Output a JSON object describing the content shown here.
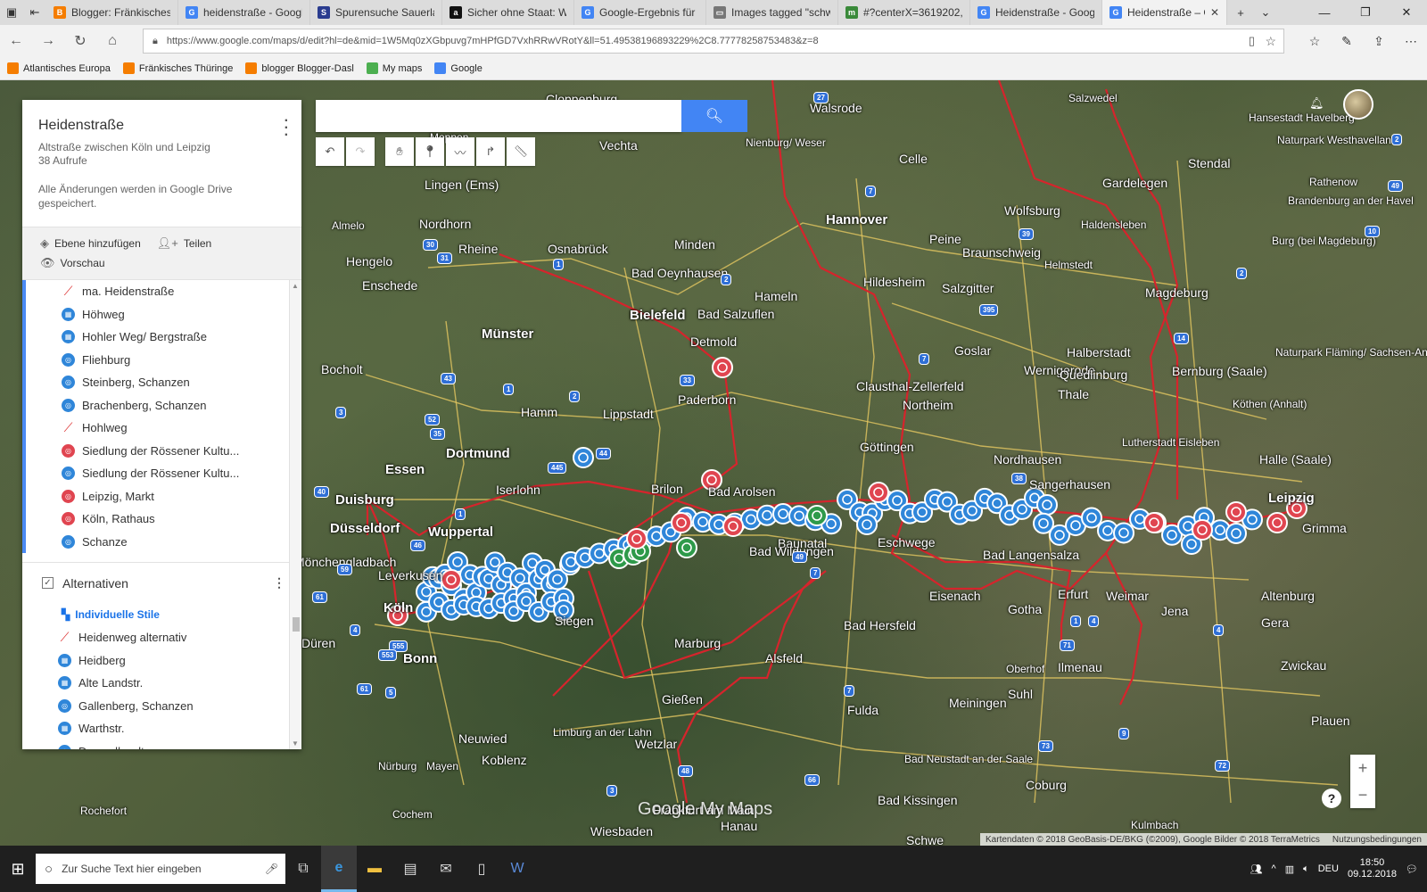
{
  "browser": {
    "tabs": [
      {
        "title": "Blogger: Fränkisches Th",
        "icon_color": "#f57d00",
        "icon": "B",
        "active": false
      },
      {
        "title": "heidenstraße - Google-",
        "icon_color": "#4285f4",
        "icon": "G",
        "active": false
      },
      {
        "title": "Spurensuche Sauerland",
        "icon_color": "#2a3c8f",
        "icon": "S",
        "active": false
      },
      {
        "title": "Sicher ohne Staat: Wie",
        "icon_color": "#111111",
        "icon": "a",
        "active": false
      },
      {
        "title": "Google-Ergebnis für htt",
        "icon_color": "#4285f4",
        "icon": "G",
        "active": false
      },
      {
        "title": "Images tagged \"schwed",
        "icon_color": "#777777",
        "icon": "▭",
        "active": false
      },
      {
        "title": "#?centerX=3619202,69:",
        "icon_color": "#3a8a3a",
        "icon": "m",
        "active": false
      },
      {
        "title": "Heidenstraße - Google",
        "icon_color": "#4285f4",
        "icon": "G",
        "active": false
      },
      {
        "title": "Heidenstraße – Goc",
        "icon_color": "#4285f4",
        "icon": "G",
        "active": true
      }
    ],
    "url": "https://www.google.com/maps/d/edit?hl=de&mid=1W5Mq0zXGbpuvg7mHPfGD7VxhRRwVRotY&ll=51.49538196893229%2C8.77778258753483&z=8",
    "favorites": [
      {
        "label": "Atlantisches Europa",
        "color": "#f57d00"
      },
      {
        "label": "Fränkisches Thüringe",
        "color": "#f57d00"
      },
      {
        "label": "blogger Blogger-Dasl",
        "color": "#f57d00"
      },
      {
        "label": "My maps",
        "color": "#4caf50"
      },
      {
        "label": "Google",
        "color": "#4285f4"
      }
    ]
  },
  "panel": {
    "title": "Heidenstraße",
    "subtitle": "Altstraße zwischen Köln und Leipzig",
    "views": "38 Aufrufe",
    "saved": "Alle Änderungen werden in Google Drive gespeichert.",
    "add_layer": "Ebene hinzufügen",
    "share": "Teilen",
    "preview": "Vorschau",
    "layer1_items": [
      {
        "label": "ma. Heidenstraße",
        "icon": "line-icon",
        "color": "red"
      },
      {
        "label": "Höhweg",
        "icon": "fortress-icon",
        "color": "blue"
      },
      {
        "label": "Hohler Weg/ Bergstraße",
        "icon": "fortress-icon",
        "color": "blue"
      },
      {
        "label": "Fliehburg",
        "icon": "target-icon",
        "color": "blue"
      },
      {
        "label": "Steinberg, Schanzen",
        "icon": "target-icon",
        "color": "blue"
      },
      {
        "label": "Brachenberg, Schanzen",
        "icon": "target-icon",
        "color": "blue"
      },
      {
        "label": "Hohlweg",
        "icon": "line-icon",
        "color": "red"
      },
      {
        "label": "Siedlung der Rössener Kultu...",
        "icon": "target-icon",
        "color": "red"
      },
      {
        "label": "Siedlung der Rössener Kultu...",
        "icon": "target-icon",
        "color": "blue"
      },
      {
        "label": "Leipzig, Markt",
        "icon": "target-icon",
        "color": "red"
      },
      {
        "label": "Köln, Rathaus",
        "icon": "target-icon",
        "color": "red"
      },
      {
        "label": "Schanze",
        "icon": "target-icon",
        "color": "blue"
      }
    ],
    "layer2": {
      "name": "Alternativen",
      "style_link": "Individuelle Stile",
      "items": [
        {
          "label": "Heidenweg alternativ",
          "icon": "line-icon",
          "color": "red"
        },
        {
          "label": "Heidberg",
          "icon": "fortress-icon",
          "color": "blue"
        },
        {
          "label": "Alte Landstr.",
          "icon": "fortress-icon",
          "color": "blue"
        },
        {
          "label": "Gallenberg, Schanzen",
          "icon": "target-icon",
          "color": "blue"
        },
        {
          "label": "Warthstr.",
          "icon": "fortress-icon",
          "color": "blue"
        },
        {
          "label": "Drosselhardt",
          "icon": "target-icon",
          "color": "blue"
        }
      ]
    }
  },
  "map": {
    "cities": [
      {
        "name": "Cloppenburg",
        "size": "normal"
      },
      {
        "name": "Walsrode",
        "size": "normal"
      },
      {
        "name": "Salzwedel",
        "size": "sm"
      },
      {
        "name": "Meppen",
        "size": "sm"
      },
      {
        "name": "Vechta",
        "size": "normal"
      },
      {
        "name": "Nienburg/ Weser",
        "size": "sm"
      },
      {
        "name": "Celle",
        "size": "normal"
      },
      {
        "name": "Hansestadt Havelberg",
        "size": "sm"
      },
      {
        "name": "Naturpark Westhavelland",
        "size": "sm"
      },
      {
        "name": "Stendal",
        "size": "normal"
      },
      {
        "name": "Lingen (Ems)",
        "size": "normal"
      },
      {
        "name": "Gardelegen",
        "size": "normal"
      },
      {
        "name": "Rathenow",
        "size": "sm"
      },
      {
        "name": "Nordhorn",
        "size": "normal"
      },
      {
        "name": "Hannover",
        "size": "big"
      },
      {
        "name": "Wolfsburg",
        "size": "normal"
      },
      {
        "name": "Brandenburg an der Havel",
        "size": "sm"
      },
      {
        "name": "Almelo",
        "size": "sm"
      },
      {
        "name": "Rheine",
        "size": "normal"
      },
      {
        "name": "Osnabrück",
        "size": "normal"
      },
      {
        "name": "Minden",
        "size": "normal"
      },
      {
        "name": "Peine",
        "size": "normal"
      },
      {
        "name": "Braunschweig",
        "size": "normal"
      },
      {
        "name": "Haldensleben",
        "size": "sm"
      },
      {
        "name": "Hengelo",
        "size": "normal"
      },
      {
        "name": "Burg (bei Magdeburg)",
        "size": "sm"
      },
      {
        "name": "Helmstedt",
        "size": "sm"
      },
      {
        "name": "Enschede",
        "size": "normal"
      },
      {
        "name": "Bad Oeynhausen",
        "size": "normal"
      },
      {
        "name": "Hameln",
        "size": "normal"
      },
      {
        "name": "Hildesheim",
        "size": "normal"
      },
      {
        "name": "Salzgitter",
        "size": "normal"
      },
      {
        "name": "Magdeburg",
        "size": "normal"
      },
      {
        "name": "Bielefeld",
        "size": "big"
      },
      {
        "name": "Bad Salzuflen",
        "size": "normal"
      },
      {
        "name": "Münster",
        "size": "big"
      },
      {
        "name": "Detmold",
        "size": "normal"
      },
      {
        "name": "Goslar",
        "size": "normal"
      },
      {
        "name": "Halberstadt",
        "size": "normal"
      },
      {
        "name": "Bocholt",
        "size": "normal"
      },
      {
        "name": "Wernigerode",
        "size": "normal"
      },
      {
        "name": "Quedlinburg",
        "size": "normal"
      },
      {
        "name": "Bernburg (Saale)",
        "size": "normal"
      },
      {
        "name": "Naturpark Fläming/ Sachsen-Anhalt",
        "size": "sm"
      },
      {
        "name": "Paderborn",
        "size": "normal"
      },
      {
        "name": "Clausthal-Zellerfeld",
        "size": "normal"
      },
      {
        "name": "Thale",
        "size": "normal"
      },
      {
        "name": "Hamm",
        "size": "normal"
      },
      {
        "name": "Lippstadt",
        "size": "normal"
      },
      {
        "name": "Northeim",
        "size": "normal"
      },
      {
        "name": "Köthen (Anhalt)",
        "size": "sm"
      },
      {
        "name": "Göttingen",
        "size": "normal"
      },
      {
        "name": "Lutherstadt Eisleben",
        "size": "sm"
      },
      {
        "name": "Essen",
        "size": "big"
      },
      {
        "name": "Dortmund",
        "size": "big"
      },
      {
        "name": "Nordhausen",
        "size": "normal"
      },
      {
        "name": "Halle (Saale)",
        "size": "normal"
      },
      {
        "name": "Duisburg",
        "size": "big"
      },
      {
        "name": "Iserlohn",
        "size": "normal"
      },
      {
        "name": "Brilon",
        "size": "normal"
      },
      {
        "name": "Bad Arolsen",
        "size": "normal"
      },
      {
        "name": "Sangerhausen",
        "size": "normal"
      },
      {
        "name": "Leipzig",
        "size": "big"
      },
      {
        "name": "Düsseldorf",
        "size": "big"
      },
      {
        "name": "Wuppertal",
        "size": "big"
      },
      {
        "name": "Baunatal",
        "size": "normal"
      },
      {
        "name": "Eschwege",
        "size": "normal"
      },
      {
        "name": "Grimma",
        "size": "normal"
      },
      {
        "name": "Mönchengladbach",
        "size": "normal"
      },
      {
        "name": "Bad Wildungen",
        "size": "normal"
      },
      {
        "name": "Bad Langensalza",
        "size": "normal"
      },
      {
        "name": "Leverkusen",
        "size": "normal"
      },
      {
        "name": "Köln",
        "size": "big"
      },
      {
        "name": "Siegen",
        "size": "normal"
      },
      {
        "name": "Eisenach",
        "size": "normal"
      },
      {
        "name": "Gotha",
        "size": "normal"
      },
      {
        "name": "Erfurt",
        "size": "normal"
      },
      {
        "name": "Weimar",
        "size": "normal"
      },
      {
        "name": "Jena",
        "size": "normal"
      },
      {
        "name": "Altenburg",
        "size": "normal"
      },
      {
        "name": "Düren",
        "size": "normal"
      },
      {
        "name": "Bonn",
        "size": "big"
      },
      {
        "name": "Marburg",
        "size": "normal"
      },
      {
        "name": "Bad Hersfeld",
        "size": "normal"
      },
      {
        "name": "Alsfeld",
        "size": "normal"
      },
      {
        "name": "Gera",
        "size": "normal"
      },
      {
        "name": "Zwickau",
        "size": "normal"
      },
      {
        "name": "Oberhof",
        "size": "sm"
      },
      {
        "name": "Suhl",
        "size": "normal"
      },
      {
        "name": "Ilmenau",
        "size": "normal"
      },
      {
        "name": "Gießen",
        "size": "normal"
      },
      {
        "name": "Fulda",
        "size": "normal"
      },
      {
        "name": "Meiningen",
        "size": "normal"
      },
      {
        "name": "Neuwied",
        "size": "normal"
      },
      {
        "name": "Wetzlar",
        "size": "normal"
      },
      {
        "name": "Limburg an der Lahn",
        "size": "sm"
      },
      {
        "name": "Plauen",
        "size": "normal"
      },
      {
        "name": "Koblenz",
        "size": "normal"
      },
      {
        "name": "Bad Neustadt an der Saale",
        "size": "sm"
      },
      {
        "name": "Nürburg",
        "size": "sm"
      },
      {
        "name": "Mayen",
        "size": "sm"
      },
      {
        "name": "Coburg",
        "size": "normal"
      },
      {
        "name": "Rochefort",
        "size": "sm"
      },
      {
        "name": "Bad Kissingen",
        "size": "normal"
      },
      {
        "name": "Cochem",
        "size": "sm"
      },
      {
        "name": "Frankfurt am Main",
        "size": "normal"
      },
      {
        "name": "Hanau",
        "size": "normal"
      },
      {
        "name": "Kulmbach",
        "size": "sm"
      },
      {
        "name": "Wiesbaden",
        "size": "normal"
      },
      {
        "name": "Schwe",
        "size": "normal"
      }
    ],
    "road_numbers": [
      "27",
      "7",
      "30",
      "31",
      "1",
      "2",
      "33",
      "43",
      "1",
      "2",
      "52",
      "35",
      "44",
      "445",
      "40",
      "1",
      "46",
      "3",
      "59",
      "61",
      "555",
      "553",
      "4",
      "1",
      "61",
      "5",
      "48",
      "7",
      "3",
      "66",
      "49",
      "7",
      "4",
      "71",
      "73",
      "9",
      "72",
      "39",
      "395",
      "7",
      "38",
      "2",
      "14",
      "10",
      "2",
      "49",
      "4"
    ],
    "logo": "Google My Maps",
    "attribution": "Kartendaten © 2018 GeoBasis-DE/BKG (©2009), Google Bilder © 2018 TerraMetrics",
    "terms": "Nutzungsbedingungen"
  },
  "taskbar": {
    "search_placeholder": "Zur Suche Text hier eingeben",
    "lang": "DEU",
    "time": "18:50",
    "date": "09.12.2018"
  }
}
